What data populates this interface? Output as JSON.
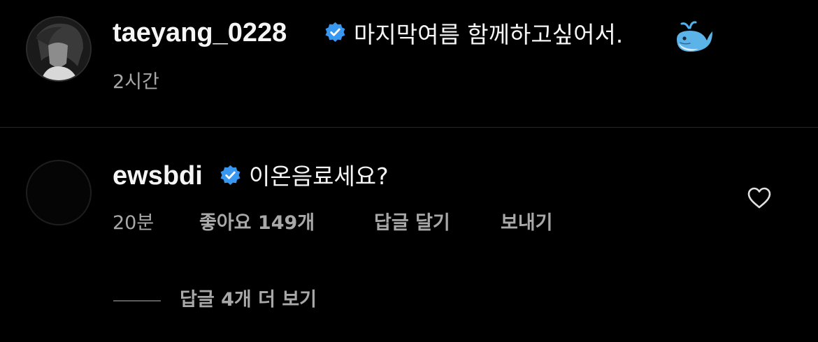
{
  "post": {
    "username": "taeyang_0228",
    "caption": "마지막여름 함께하고싶어서.",
    "caption_emoji_icon": "spouting-whale-icon",
    "time": "2시간"
  },
  "comment": {
    "username": "ewsbdi",
    "text": "이온음료세요?",
    "time": "20분",
    "likes": "좋아요 149개",
    "reply_label": "답글 달기",
    "send_label": "보내기",
    "like_icon": "heart-outline-icon"
  },
  "replies": {
    "view_more_label": "답글 4개 더 보기"
  },
  "colors": {
    "background": "#000000",
    "primary_text": "#f5f5f5",
    "secondary_text": "#a8a8a8",
    "verified_badge": "#3897f0",
    "divider": "#262626"
  }
}
